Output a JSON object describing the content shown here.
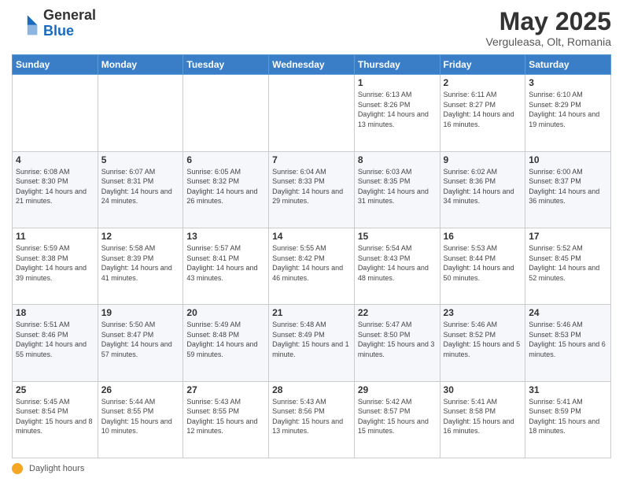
{
  "header": {
    "logo_general": "General",
    "logo_blue": "Blue",
    "month_title": "May 2025",
    "location": "Verguleasa, Olt, Romania"
  },
  "footer": {
    "daylight_label": "Daylight hours"
  },
  "weekdays": [
    "Sunday",
    "Monday",
    "Tuesday",
    "Wednesday",
    "Thursday",
    "Friday",
    "Saturday"
  ],
  "weeks": [
    [
      {
        "day": "",
        "info": ""
      },
      {
        "day": "",
        "info": ""
      },
      {
        "day": "",
        "info": ""
      },
      {
        "day": "",
        "info": ""
      },
      {
        "day": "1",
        "info": "Sunrise: 6:13 AM\nSunset: 8:26 PM\nDaylight: 14 hours\nand 13 minutes."
      },
      {
        "day": "2",
        "info": "Sunrise: 6:11 AM\nSunset: 8:27 PM\nDaylight: 14 hours\nand 16 minutes."
      },
      {
        "day": "3",
        "info": "Sunrise: 6:10 AM\nSunset: 8:29 PM\nDaylight: 14 hours\nand 19 minutes."
      }
    ],
    [
      {
        "day": "4",
        "info": "Sunrise: 6:08 AM\nSunset: 8:30 PM\nDaylight: 14 hours\nand 21 minutes."
      },
      {
        "day": "5",
        "info": "Sunrise: 6:07 AM\nSunset: 8:31 PM\nDaylight: 14 hours\nand 24 minutes."
      },
      {
        "day": "6",
        "info": "Sunrise: 6:05 AM\nSunset: 8:32 PM\nDaylight: 14 hours\nand 26 minutes."
      },
      {
        "day": "7",
        "info": "Sunrise: 6:04 AM\nSunset: 8:33 PM\nDaylight: 14 hours\nand 29 minutes."
      },
      {
        "day": "8",
        "info": "Sunrise: 6:03 AM\nSunset: 8:35 PM\nDaylight: 14 hours\nand 31 minutes."
      },
      {
        "day": "9",
        "info": "Sunrise: 6:02 AM\nSunset: 8:36 PM\nDaylight: 14 hours\nand 34 minutes."
      },
      {
        "day": "10",
        "info": "Sunrise: 6:00 AM\nSunset: 8:37 PM\nDaylight: 14 hours\nand 36 minutes."
      }
    ],
    [
      {
        "day": "11",
        "info": "Sunrise: 5:59 AM\nSunset: 8:38 PM\nDaylight: 14 hours\nand 39 minutes."
      },
      {
        "day": "12",
        "info": "Sunrise: 5:58 AM\nSunset: 8:39 PM\nDaylight: 14 hours\nand 41 minutes."
      },
      {
        "day": "13",
        "info": "Sunrise: 5:57 AM\nSunset: 8:41 PM\nDaylight: 14 hours\nand 43 minutes."
      },
      {
        "day": "14",
        "info": "Sunrise: 5:55 AM\nSunset: 8:42 PM\nDaylight: 14 hours\nand 46 minutes."
      },
      {
        "day": "15",
        "info": "Sunrise: 5:54 AM\nSunset: 8:43 PM\nDaylight: 14 hours\nand 48 minutes."
      },
      {
        "day": "16",
        "info": "Sunrise: 5:53 AM\nSunset: 8:44 PM\nDaylight: 14 hours\nand 50 minutes."
      },
      {
        "day": "17",
        "info": "Sunrise: 5:52 AM\nSunset: 8:45 PM\nDaylight: 14 hours\nand 52 minutes."
      }
    ],
    [
      {
        "day": "18",
        "info": "Sunrise: 5:51 AM\nSunset: 8:46 PM\nDaylight: 14 hours\nand 55 minutes."
      },
      {
        "day": "19",
        "info": "Sunrise: 5:50 AM\nSunset: 8:47 PM\nDaylight: 14 hours\nand 57 minutes."
      },
      {
        "day": "20",
        "info": "Sunrise: 5:49 AM\nSunset: 8:48 PM\nDaylight: 14 hours\nand 59 minutes."
      },
      {
        "day": "21",
        "info": "Sunrise: 5:48 AM\nSunset: 8:49 PM\nDaylight: 15 hours\nand 1 minute."
      },
      {
        "day": "22",
        "info": "Sunrise: 5:47 AM\nSunset: 8:50 PM\nDaylight: 15 hours\nand 3 minutes."
      },
      {
        "day": "23",
        "info": "Sunrise: 5:46 AM\nSunset: 8:52 PM\nDaylight: 15 hours\nand 5 minutes."
      },
      {
        "day": "24",
        "info": "Sunrise: 5:46 AM\nSunset: 8:53 PM\nDaylight: 15 hours\nand 6 minutes."
      }
    ],
    [
      {
        "day": "25",
        "info": "Sunrise: 5:45 AM\nSunset: 8:54 PM\nDaylight: 15 hours\nand 8 minutes."
      },
      {
        "day": "26",
        "info": "Sunrise: 5:44 AM\nSunset: 8:55 PM\nDaylight: 15 hours\nand 10 minutes."
      },
      {
        "day": "27",
        "info": "Sunrise: 5:43 AM\nSunset: 8:55 PM\nDaylight: 15 hours\nand 12 minutes."
      },
      {
        "day": "28",
        "info": "Sunrise: 5:43 AM\nSunset: 8:56 PM\nDaylight: 15 hours\nand 13 minutes."
      },
      {
        "day": "29",
        "info": "Sunrise: 5:42 AM\nSunset: 8:57 PM\nDaylight: 15 hours\nand 15 minutes."
      },
      {
        "day": "30",
        "info": "Sunrise: 5:41 AM\nSunset: 8:58 PM\nDaylight: 15 hours\nand 16 minutes."
      },
      {
        "day": "31",
        "info": "Sunrise: 5:41 AM\nSunset: 8:59 PM\nDaylight: 15 hours\nand 18 minutes."
      }
    ]
  ]
}
